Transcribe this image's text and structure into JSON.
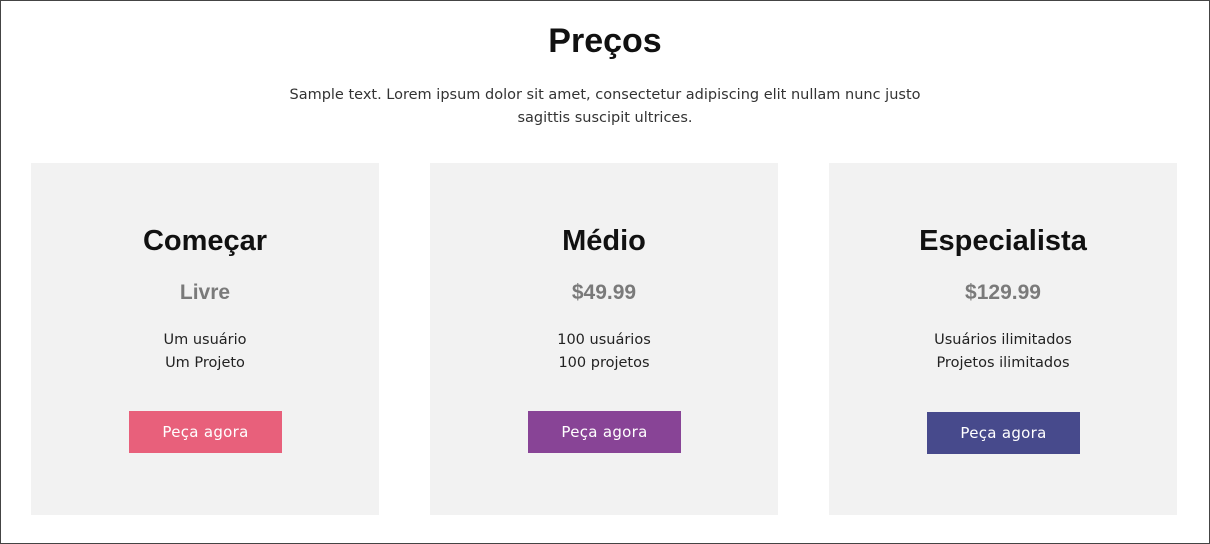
{
  "header": {
    "title": "Preços",
    "subtitle": "Sample text. Lorem ipsum dolor sit amet, consectetur adipiscing elit nullam nunc justo sagittis suscipit ultrices."
  },
  "plans": [
    {
      "name": "Começar",
      "price": "Livre",
      "features": [
        "Um usuário",
        "Um Projeto"
      ],
      "button_label": "Peça agora",
      "button_color": "#e8607b"
    },
    {
      "name": "Médio",
      "price": "$49.99",
      "features": [
        "100 usuários",
        "100 projetos"
      ],
      "button_label": "Peça agora",
      "button_color": "#884496"
    },
    {
      "name": "Especialista",
      "price": "$129.99",
      "features": [
        "Usuários ilimitados",
        "Projetos ilimitados"
      ],
      "button_label": "Peça agora",
      "button_color": "#474a8c"
    }
  ],
  "colors": {
    "card_background": "#f2f2f2",
    "price_text": "#7a7a7a",
    "title_text": "#111111"
  }
}
